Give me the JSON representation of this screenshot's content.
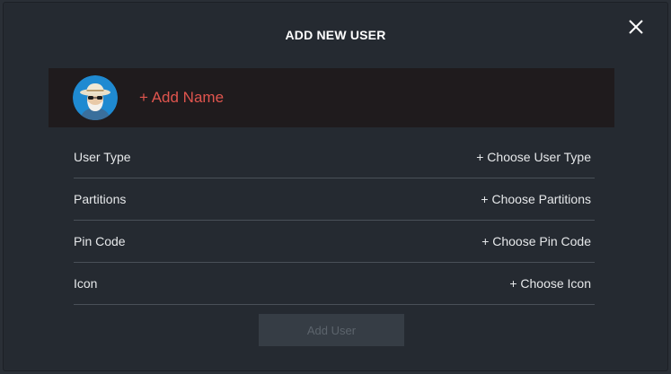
{
  "modal": {
    "title": "ADD NEW USER",
    "close_icon": "close-icon"
  },
  "profile": {
    "avatar_icon": "avatar",
    "add_name_label": "+ Add Name"
  },
  "fields": [
    {
      "label": "User Type",
      "action": "+ Choose User Type"
    },
    {
      "label": "Partitions",
      "action": "+ Choose Partitions"
    },
    {
      "label": "Pin Code",
      "action": "+ Choose Pin Code"
    },
    {
      "label": "Icon",
      "action": "+ Choose Icon"
    }
  ],
  "footer": {
    "add_user_label": "Add User",
    "add_user_disabled": true
  },
  "colors": {
    "background": "#252a31",
    "name_row": "#1f1b1d",
    "accent_red": "#e0554e",
    "divider": "#4a5058",
    "button_disabled": "#363d45"
  }
}
